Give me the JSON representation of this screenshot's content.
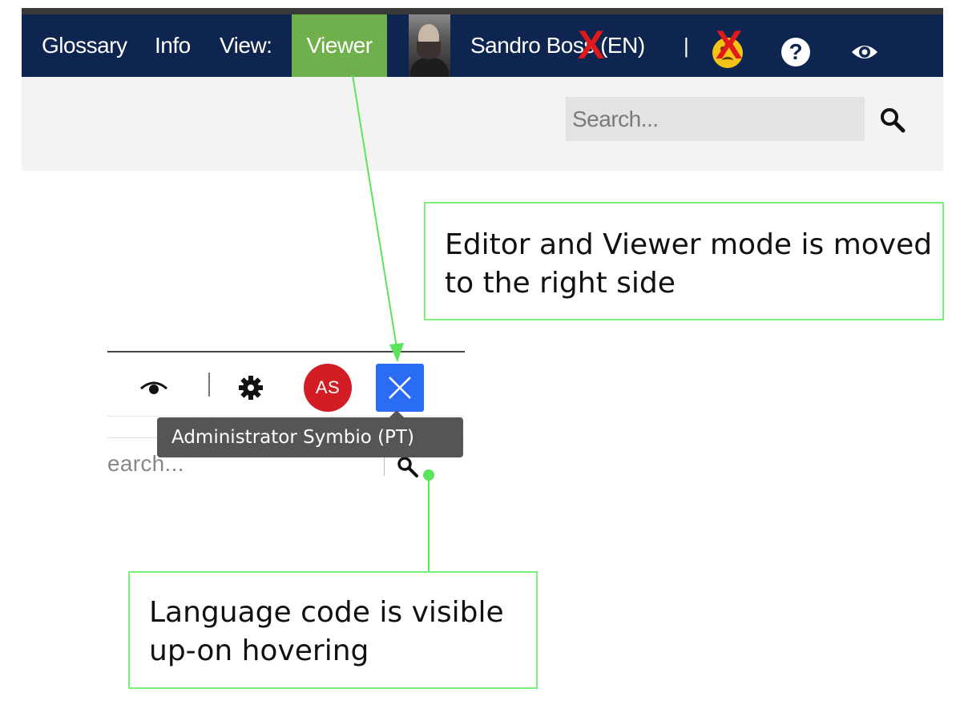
{
  "old_ui": {
    "nav": {
      "glossary": "Glossary",
      "info": "Info",
      "view_label": "View:",
      "view_mode": "Viewer",
      "user": "Sandro Boss (EN)",
      "separator": "|",
      "strike_mark": "X"
    },
    "search_placeholder": "Search...",
    "colors": {
      "nav_bg": "#0e2550",
      "viewer_active": "#6fb04c",
      "strike": "#e01a1a"
    }
  },
  "new_ui": {
    "avatar_initials": "AS",
    "search_placeholder_partial": "earch...",
    "tooltip": "Administrator Symbio (PT)",
    "colors": {
      "avatar_bg": "#d21d25",
      "close_btn_bg": "#2a6cf4",
      "tooltip_bg": "#555555"
    }
  },
  "callouts": {
    "mode_moved": "Editor and Viewer mode is moved to the right side",
    "language_code": "Language code is visible up-on hovering"
  },
  "annotation_color": "#5ce35c"
}
